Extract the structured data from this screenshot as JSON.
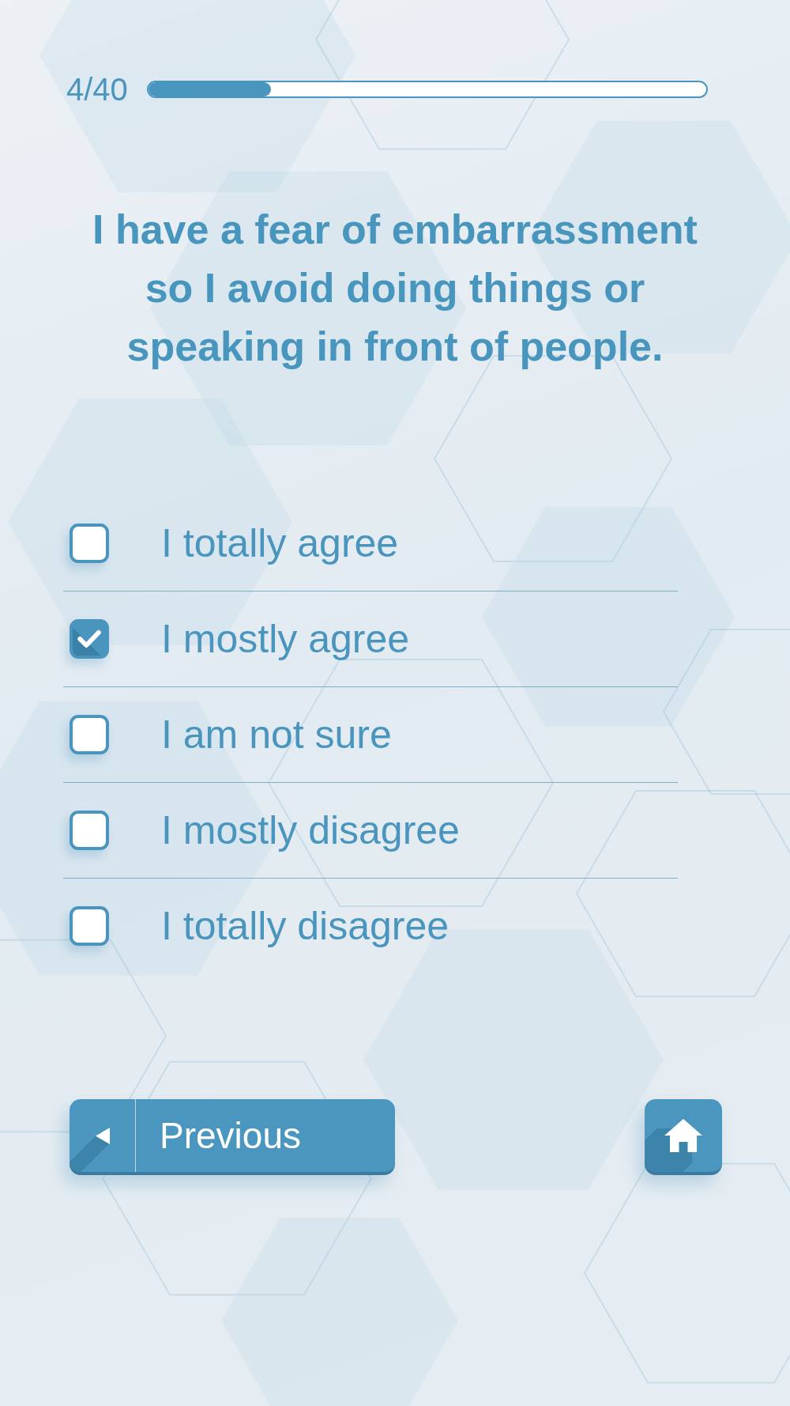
{
  "progress": {
    "counter": "4/40",
    "level": 0.22
  },
  "question": "I have a fear of embarrassment so I avoid doing things or speaking in front of people.",
  "options": [
    {
      "label": "I totally agree",
      "checked": false
    },
    {
      "label": "I mostly agree",
      "checked": true
    },
    {
      "label": "I am not sure",
      "checked": false
    },
    {
      "label": "I mostly disagree",
      "checked": false
    },
    {
      "label": "I totally disagree",
      "checked": false
    }
  ],
  "navigation": {
    "previous_label": "Previous"
  }
}
